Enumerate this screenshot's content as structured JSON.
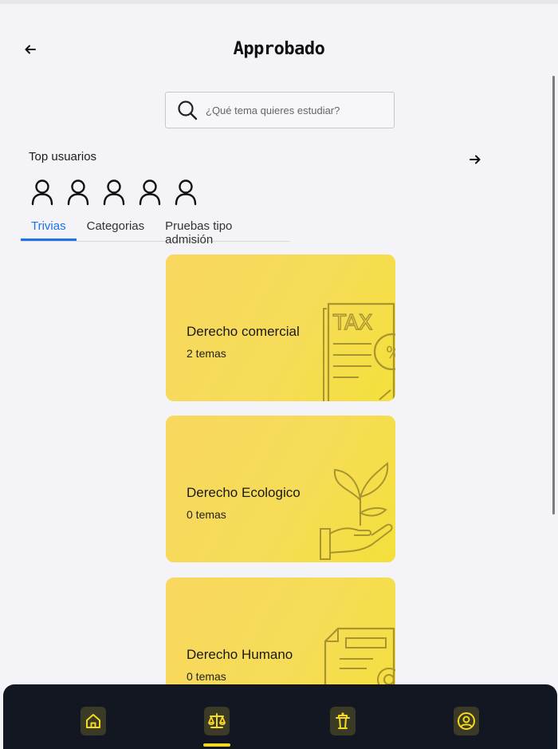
{
  "header": {
    "title": "Approbado"
  },
  "search": {
    "placeholder": "¿Qué tema quieres estudiar?"
  },
  "top_users": {
    "label": "Top usuarios",
    "count": 5
  },
  "tabs": [
    {
      "label": "Trivias",
      "active": true
    },
    {
      "label": "Categorias",
      "active": false
    },
    {
      "label": "Pruebas tipo admisión",
      "active": false
    }
  ],
  "cards": [
    {
      "title": "Derecho comercial",
      "subtitle": "2 temas",
      "icon": "tax-document-icon"
    },
    {
      "title": "Derecho Ecologico",
      "subtitle": "0 temas",
      "icon": "plant-hand-icon"
    },
    {
      "title": "Derecho Humano",
      "subtitle": "0 temas",
      "icon": "document-gear-icon"
    }
  ],
  "bottom_nav": {
    "items": [
      "home-icon",
      "scales-icon",
      "podium-icon",
      "user-circle-icon"
    ],
    "active": "scales-icon"
  },
  "colors": {
    "accent_tab": "#1e73e8",
    "card_yellow": "#f8d85e",
    "nav_bg": "#121722",
    "nav_icon": "#f5d91e"
  }
}
